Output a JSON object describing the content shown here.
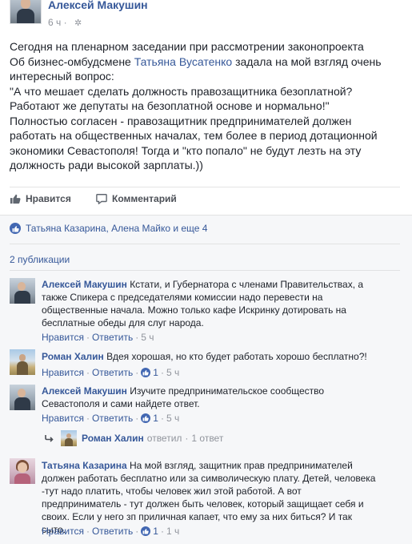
{
  "post": {
    "author": "Алексей Макушин",
    "time": "6 ч",
    "text_line1": "Сегодня на пленарном заседании при рассмотрении законопроекта",
    "text_line2_a": "Об бизнес-омбудсмене ",
    "text_line2_link": "Татьяна Вусатенко",
    "text_line2_b": " задала на мой взгляд очень",
    "text_rest": [
      "интересный вопрос:",
      "\"А что мешает сделать должность правозащитника безоплатной?",
      "Работают же депутаты на безоплатной основе и нормально!\"",
      "Полностью согласен - правозащитник предпринимателей должен",
      "работать на общественных началах, тем более в период дотационной",
      "экономики Севастополя! Тогда и \"кто попало\" не будут лезть на эту",
      "должность ради высокой зарплаты.))"
    ]
  },
  "actions": {
    "like": "Нравится",
    "comment": "Комментарий"
  },
  "likes": {
    "text": "Татьяна Казарина, Алена Майко и еще 4"
  },
  "publications": "2 публикации",
  "labels": {
    "like": "Нравится",
    "reply": "Ответить",
    "dot": "·"
  },
  "comments": [
    {
      "author": "Алексей Макушин",
      "text": "Кстати, и Губернатора с членами Правительствах, а также Спикера с председателями комиссии надо перевести на общественные начала. Можно только кафе Искринку дотировать на бесплатные обеды для слуг народа.",
      "likes": "",
      "time": "5 ч"
    },
    {
      "author": "Роман Халин",
      "text": "Вдея хорошая, но кто будет работать хорошо бесплатно?!",
      "likes": "1",
      "time": "5 ч"
    },
    {
      "author": "Алексей Макушин",
      "text": "Изучите предпринимательское сообщество Севастополя и сами найдете ответ.",
      "likes": "1",
      "time": "5 ч"
    },
    {
      "author": "Татьяна Казарина",
      "text": "На мой взгляд, защитник прав предпринимателей должен работать бесплатно или за символическую плату. Детей, человека -тут надо платить, чтобы человек жил этой работой. А вот предприниматель - тут должен быть человек, который защищает себя и своих. Если у него зп приличная капает, что ему за них биться? И так сыто.",
      "likes": "1",
      "time": "1 ч"
    }
  ],
  "reply_thread": {
    "author": "Роман Халин",
    "action": "ответил",
    "count": "1 ответ"
  },
  "colors": {
    "link": "#365899",
    "muted": "#90949c",
    "like_blue": "#4267b2",
    "ufi_bg": "#f6f7f9"
  }
}
